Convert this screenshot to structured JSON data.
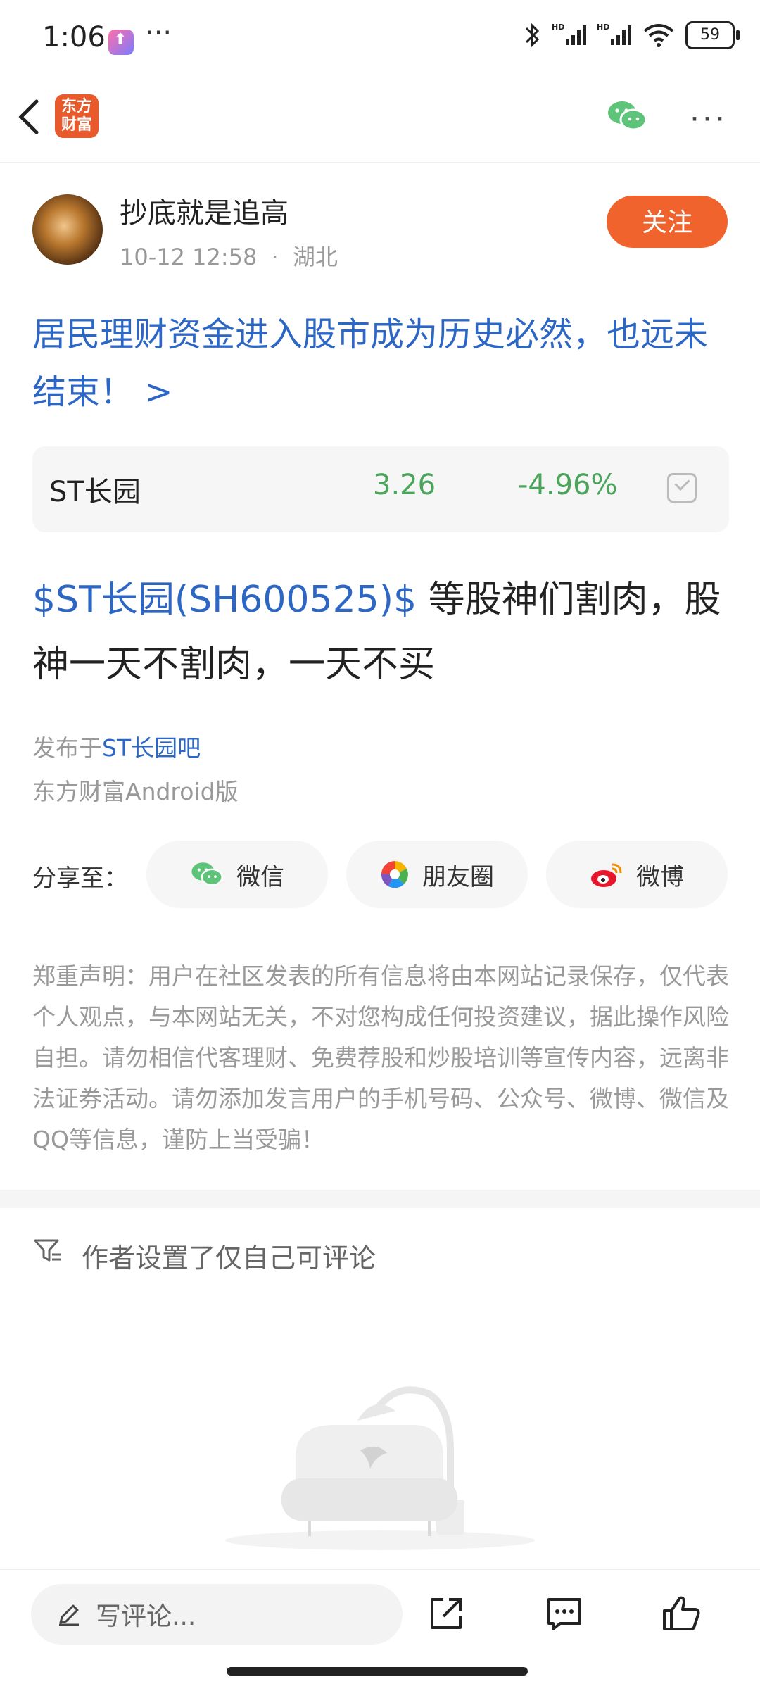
{
  "status_bar": {
    "time": "1:06",
    "more": "···",
    "battery": "59"
  },
  "nav": {
    "logo_text": "东方\n财富",
    "more": "···"
  },
  "post": {
    "author": "抄底就是追高",
    "date": "10-12 12:58",
    "separator": "·",
    "location": "湖北",
    "follow_label": "关注",
    "title_link": "居民理财资金进入股市成为历史必然，也远未结束！ >",
    "stock": {
      "name": "ST长园",
      "price": "3.26",
      "change": "-4.96%"
    },
    "cashtag": "$ST长园(SH600525)$",
    "body": " 等股神们割肉，股神一天不割肉，一天不买",
    "published_in_prefix": "发布于",
    "published_in_bar": "ST长园吧",
    "client": "东方财富Android版"
  },
  "share": {
    "label": "分享至：",
    "wechat": "微信",
    "moments": "朋友圈",
    "weibo": "微博"
  },
  "disclaimer": "郑重声明：用户在社区发表的所有信息将由本网站记录保存，仅代表个人观点，与本网站无关，不对您构成任何投资建议，据此操作风险自担。请勿相信代客理财、免费荐股和炒股培训等宣传内容，远离非法证券活动。请勿添加发言用户的手机号码、公众号、微博、微信及QQ等信息，谨防上当受骗！",
  "comments": {
    "notice": "作者设置了仅自己可评论"
  },
  "bottom_bar": {
    "placeholder": "写评论..."
  },
  "colors": {
    "accent": "#f0632c",
    "link": "#2d67c5",
    "down": "#4aa55a"
  }
}
